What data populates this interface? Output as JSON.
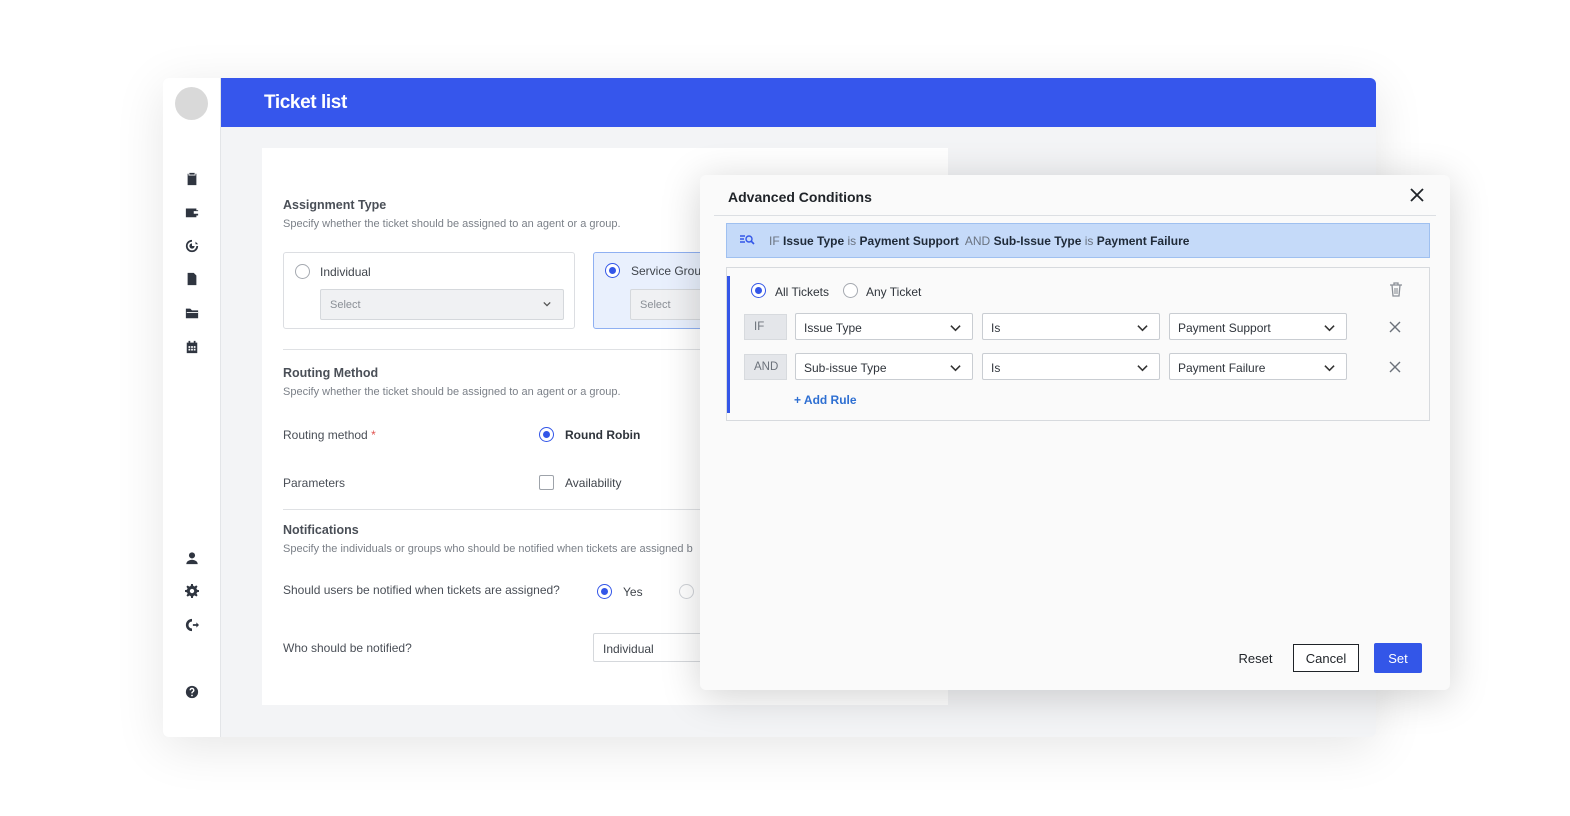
{
  "header": {
    "title": "Ticket list"
  },
  "assignment": {
    "title": "Assignment Type",
    "description": "Specify whether the ticket should be assigned to an agent or a group.",
    "options": [
      {
        "label": "Individual",
        "selected": false,
        "select_placeholder": "Select"
      },
      {
        "label": "Service Grou",
        "selected": true,
        "select_placeholder": "Select"
      }
    ]
  },
  "routing": {
    "title": "Routing Method",
    "description": "Specify whether the ticket should be assigned to an agent or a group.",
    "method_label": "Routing method",
    "required_mark": "*",
    "method_value": "Round Robin",
    "parameters_label": "Parameters",
    "parameter_option": "Availability"
  },
  "notifications": {
    "title": "Notifications",
    "description": "Specify the individuals or groups who should be notified when tickets are assigned b",
    "question": "Should users be notified when tickets are assigned?",
    "answer_yes": "Yes",
    "who_label": "Who should be notified?",
    "who_value": "Individual"
  },
  "modal": {
    "title": "Advanced Conditions",
    "summary": {
      "if_kw": "IF",
      "field1": "Issue Type",
      "is_kw1": "is",
      "value1": "Payment Support",
      "and_kw": "AND",
      "field2": "Sub-Issue Type",
      "is_kw2": "is",
      "value2": "Payment Failure"
    },
    "match": {
      "all_label": "All Tickets",
      "any_label": "Any Ticket",
      "selected": "all"
    },
    "rules": [
      {
        "op": "IF",
        "field": "Issue Type",
        "operator": "Is",
        "value": "Payment Support"
      },
      {
        "op": "AND",
        "field": "Sub-issue Type",
        "operator": "Is",
        "value": "Payment Failure"
      }
    ],
    "add_rule": "+ Add Rule",
    "buttons": {
      "reset": "Reset",
      "cancel": "Cancel",
      "set": "Set"
    }
  },
  "colors": {
    "primary": "#3656ec",
    "accent": "#3356e8",
    "link": "#2e6fd2",
    "summary_bg": "#c5daf9"
  },
  "icons": {
    "sidebar_top": [
      "clipboard-icon",
      "wallet-icon",
      "target-icon",
      "document-icon",
      "folder-icon",
      "calendar-icon"
    ],
    "sidebar_bottom": [
      "user-icon",
      "gear-icon",
      "logout-icon",
      "help-icon"
    ]
  }
}
